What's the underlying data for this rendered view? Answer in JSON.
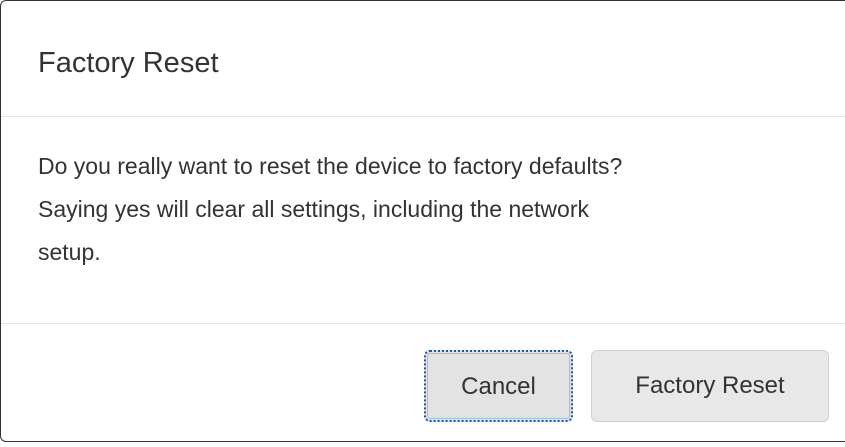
{
  "dialog": {
    "title": "Factory Reset",
    "message_line_1": "Do you really want to reset the device to factory defaults?",
    "message_line_2": "Saying yes will clear all settings, including the network",
    "message_line_3": "setup.",
    "buttons": {
      "cancel_label": "Cancel",
      "confirm_label": "Factory Reset"
    }
  },
  "colors": {
    "text": "#333333",
    "button_bg": "#e8e8e8",
    "divider": "#e5e5e5",
    "focus_ring": "#1f5aa6"
  }
}
